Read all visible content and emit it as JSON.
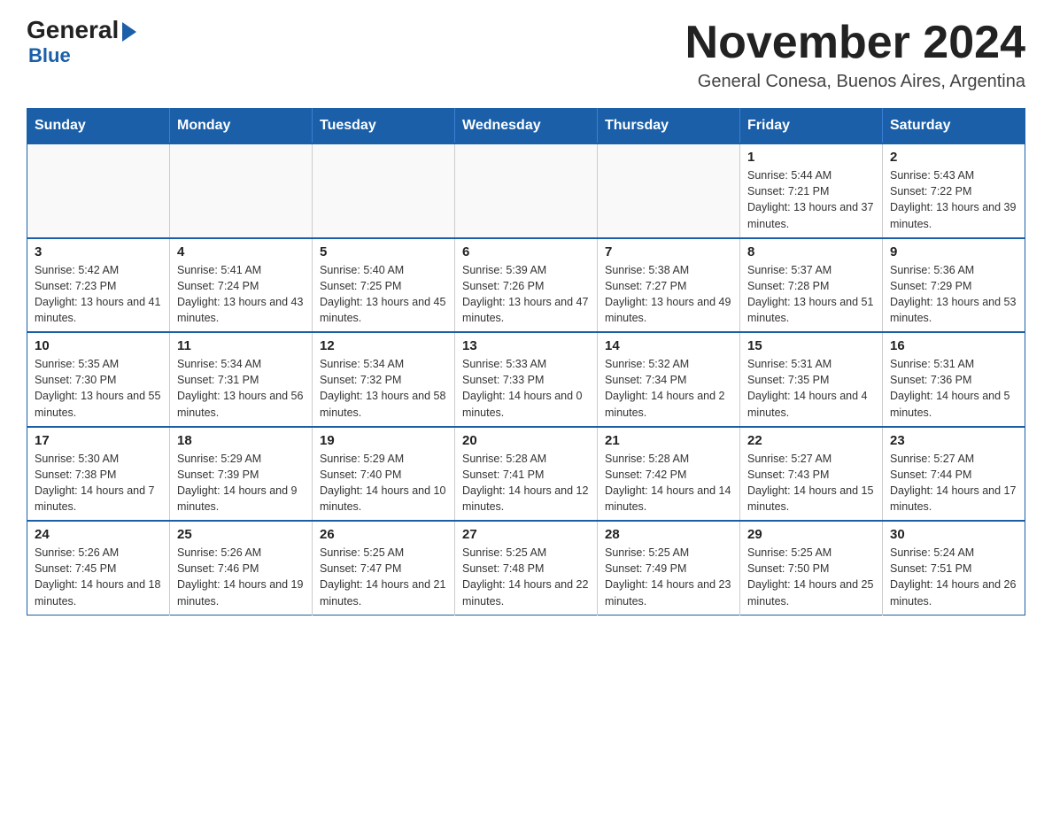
{
  "logo": {
    "general": "General",
    "blue": "Blue"
  },
  "title": "November 2024",
  "subtitle": "General Conesa, Buenos Aires, Argentina",
  "weekdays": [
    "Sunday",
    "Monday",
    "Tuesday",
    "Wednesday",
    "Thursday",
    "Friday",
    "Saturday"
  ],
  "weeks": [
    [
      {
        "day": "",
        "info": ""
      },
      {
        "day": "",
        "info": ""
      },
      {
        "day": "",
        "info": ""
      },
      {
        "day": "",
        "info": ""
      },
      {
        "day": "",
        "info": ""
      },
      {
        "day": "1",
        "info": "Sunrise: 5:44 AM\nSunset: 7:21 PM\nDaylight: 13 hours and 37 minutes."
      },
      {
        "day": "2",
        "info": "Sunrise: 5:43 AM\nSunset: 7:22 PM\nDaylight: 13 hours and 39 minutes."
      }
    ],
    [
      {
        "day": "3",
        "info": "Sunrise: 5:42 AM\nSunset: 7:23 PM\nDaylight: 13 hours and 41 minutes."
      },
      {
        "day": "4",
        "info": "Sunrise: 5:41 AM\nSunset: 7:24 PM\nDaylight: 13 hours and 43 minutes."
      },
      {
        "day": "5",
        "info": "Sunrise: 5:40 AM\nSunset: 7:25 PM\nDaylight: 13 hours and 45 minutes."
      },
      {
        "day": "6",
        "info": "Sunrise: 5:39 AM\nSunset: 7:26 PM\nDaylight: 13 hours and 47 minutes."
      },
      {
        "day": "7",
        "info": "Sunrise: 5:38 AM\nSunset: 7:27 PM\nDaylight: 13 hours and 49 minutes."
      },
      {
        "day": "8",
        "info": "Sunrise: 5:37 AM\nSunset: 7:28 PM\nDaylight: 13 hours and 51 minutes."
      },
      {
        "day": "9",
        "info": "Sunrise: 5:36 AM\nSunset: 7:29 PM\nDaylight: 13 hours and 53 minutes."
      }
    ],
    [
      {
        "day": "10",
        "info": "Sunrise: 5:35 AM\nSunset: 7:30 PM\nDaylight: 13 hours and 55 minutes."
      },
      {
        "day": "11",
        "info": "Sunrise: 5:34 AM\nSunset: 7:31 PM\nDaylight: 13 hours and 56 minutes."
      },
      {
        "day": "12",
        "info": "Sunrise: 5:34 AM\nSunset: 7:32 PM\nDaylight: 13 hours and 58 minutes."
      },
      {
        "day": "13",
        "info": "Sunrise: 5:33 AM\nSunset: 7:33 PM\nDaylight: 14 hours and 0 minutes."
      },
      {
        "day": "14",
        "info": "Sunrise: 5:32 AM\nSunset: 7:34 PM\nDaylight: 14 hours and 2 minutes."
      },
      {
        "day": "15",
        "info": "Sunrise: 5:31 AM\nSunset: 7:35 PM\nDaylight: 14 hours and 4 minutes."
      },
      {
        "day": "16",
        "info": "Sunrise: 5:31 AM\nSunset: 7:36 PM\nDaylight: 14 hours and 5 minutes."
      }
    ],
    [
      {
        "day": "17",
        "info": "Sunrise: 5:30 AM\nSunset: 7:38 PM\nDaylight: 14 hours and 7 minutes."
      },
      {
        "day": "18",
        "info": "Sunrise: 5:29 AM\nSunset: 7:39 PM\nDaylight: 14 hours and 9 minutes."
      },
      {
        "day": "19",
        "info": "Sunrise: 5:29 AM\nSunset: 7:40 PM\nDaylight: 14 hours and 10 minutes."
      },
      {
        "day": "20",
        "info": "Sunrise: 5:28 AM\nSunset: 7:41 PM\nDaylight: 14 hours and 12 minutes."
      },
      {
        "day": "21",
        "info": "Sunrise: 5:28 AM\nSunset: 7:42 PM\nDaylight: 14 hours and 14 minutes."
      },
      {
        "day": "22",
        "info": "Sunrise: 5:27 AM\nSunset: 7:43 PM\nDaylight: 14 hours and 15 minutes."
      },
      {
        "day": "23",
        "info": "Sunrise: 5:27 AM\nSunset: 7:44 PM\nDaylight: 14 hours and 17 minutes."
      }
    ],
    [
      {
        "day": "24",
        "info": "Sunrise: 5:26 AM\nSunset: 7:45 PM\nDaylight: 14 hours and 18 minutes."
      },
      {
        "day": "25",
        "info": "Sunrise: 5:26 AM\nSunset: 7:46 PM\nDaylight: 14 hours and 19 minutes."
      },
      {
        "day": "26",
        "info": "Sunrise: 5:25 AM\nSunset: 7:47 PM\nDaylight: 14 hours and 21 minutes."
      },
      {
        "day": "27",
        "info": "Sunrise: 5:25 AM\nSunset: 7:48 PM\nDaylight: 14 hours and 22 minutes."
      },
      {
        "day": "28",
        "info": "Sunrise: 5:25 AM\nSunset: 7:49 PM\nDaylight: 14 hours and 23 minutes."
      },
      {
        "day": "29",
        "info": "Sunrise: 5:25 AM\nSunset: 7:50 PM\nDaylight: 14 hours and 25 minutes."
      },
      {
        "day": "30",
        "info": "Sunrise: 5:24 AM\nSunset: 7:51 PM\nDaylight: 14 hours and 26 minutes."
      }
    ]
  ]
}
